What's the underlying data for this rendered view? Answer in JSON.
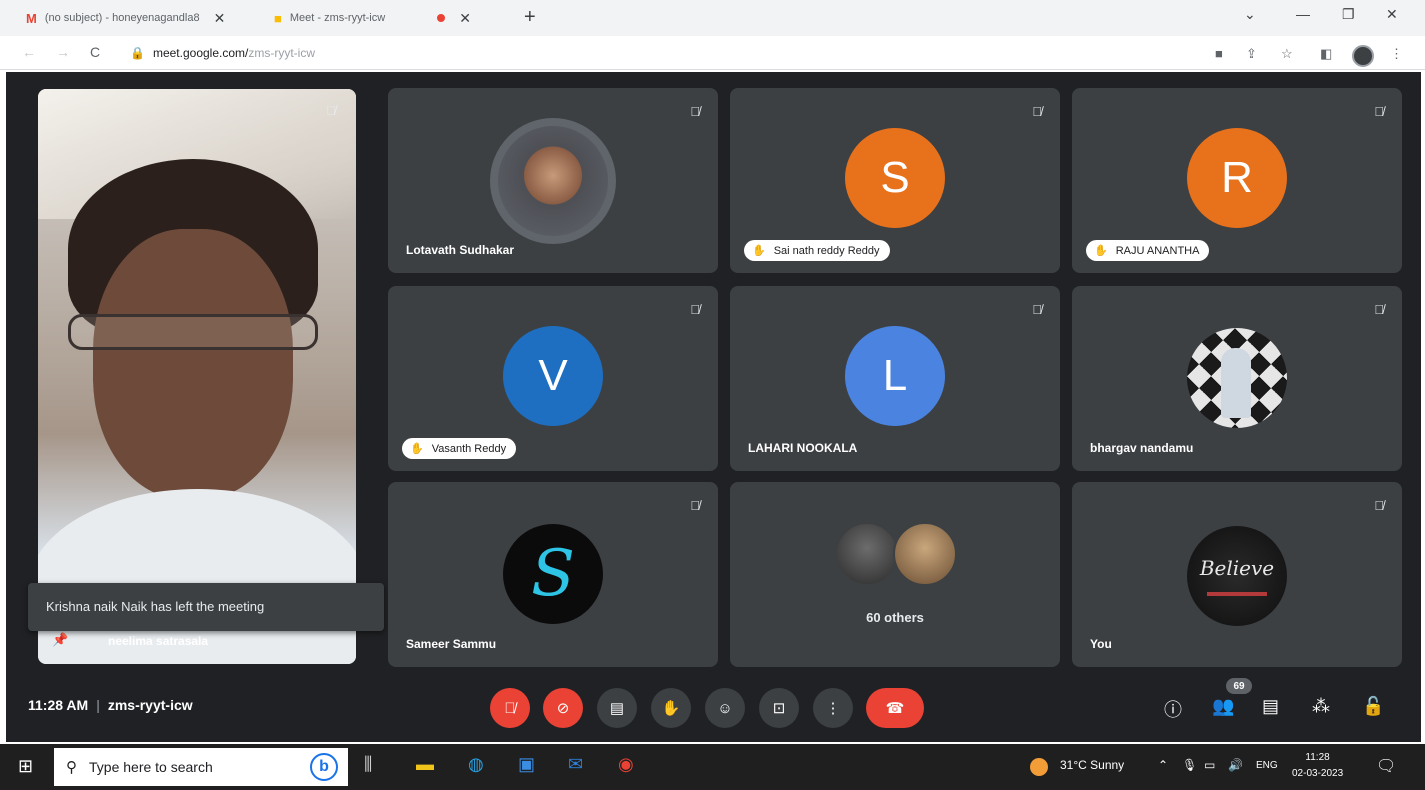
{
  "browser": {
    "tabs": [
      {
        "label": "(no subject) - honeyenagandla8",
        "icon": "gmail-icon"
      },
      {
        "label": "Meet - zms-ryyt-icw",
        "icon": "meet-icon"
      }
    ],
    "url_domain": "meet.google.com/",
    "url_path": "zms-ryyt-icw"
  },
  "self_tile": {
    "name": "neelima satrasala"
  },
  "toast": "Krishna naik Naik has left the meeting",
  "tiles": [
    {
      "name": "Lotavath Sudhakar",
      "type": "photo"
    },
    {
      "name": "Sai nath reddy Reddy",
      "type": "initial",
      "initial": "S",
      "color": "#e8711c",
      "hand_raised": true
    },
    {
      "name": "RAJU ANANTHA",
      "type": "initial",
      "initial": "R",
      "color": "#e8711c",
      "hand_raised": true
    },
    {
      "name": "Vasanth Reddy",
      "type": "initial",
      "initial": "V",
      "color": "#1e6fc1",
      "hand_raised": true
    },
    {
      "name": "LAHARI NOOKALA",
      "type": "initial",
      "initial": "L",
      "color": "#4a84e0"
    },
    {
      "name": "bhargav nandamu",
      "type": "photo"
    },
    {
      "name": "Sameer Sammu",
      "type": "photo"
    },
    {
      "name": "60 others",
      "type": "group"
    },
    {
      "name": "You",
      "type": "photo",
      "photo_text": "Believe"
    }
  ],
  "controls": {
    "time": "11:28 AM",
    "meeting_code": "zms-ryyt-icw",
    "participant_count": "69"
  },
  "taskbar": {
    "search_placeholder": "Type here to search",
    "weather": "31°C  Sunny",
    "lang": "ENG",
    "clock_time": "11:28",
    "clock_date": "02-03-2023"
  }
}
